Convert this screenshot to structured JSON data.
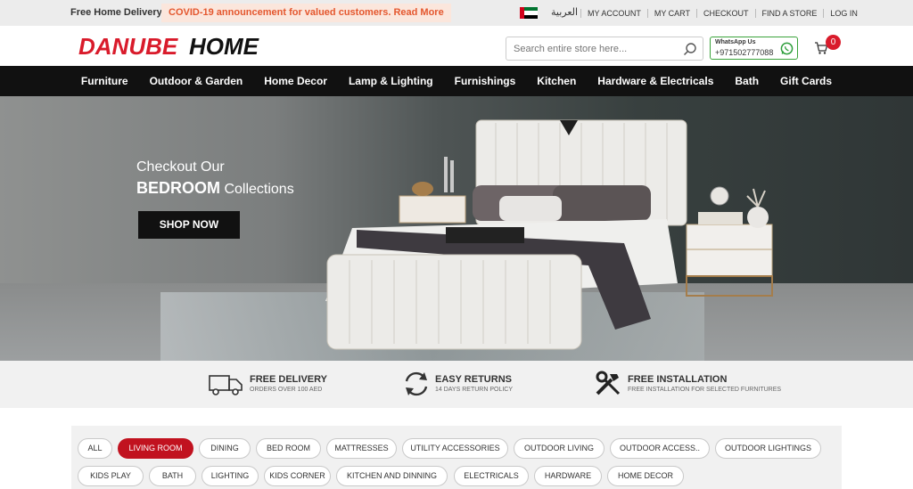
{
  "topbar": {
    "free_delivery": "Free Home Delivery",
    "covid_notice": "COVID-19 announcement for valued customers. Read More",
    "language": "العربية",
    "links": [
      "MY ACCOUNT",
      "MY CART",
      "CHECKOUT",
      "FIND A STORE",
      "LOG IN"
    ]
  },
  "header": {
    "logo_text": "DANUBE HOME",
    "search_placeholder": "Search entire store here...",
    "whatsapp_label": "WhatsApp Us",
    "whatsapp_number": "+971502777088",
    "cart_count": "0"
  },
  "nav": {
    "items": [
      "Furniture",
      "Outdoor & Garden",
      "Home Decor",
      "Lamp & Lighting",
      "Furnishings",
      "Kitchen",
      "Hardware & Electricals",
      "Bath",
      "Gift Cards"
    ]
  },
  "hero": {
    "line1": "Checkout Our",
    "line2_bold": "BEDROOM",
    "line2_rest": " Collections",
    "cta": "SHOP NOW"
  },
  "features": [
    {
      "title": "FREE DELIVERY",
      "subtitle": "ORDERS OVER 100 AED",
      "icon": "truck-icon"
    },
    {
      "title": "EASY RETURNS",
      "subtitle": "14 DAYS RETURN POLICY",
      "icon": "returns-icon"
    },
    {
      "title": "FREE INSTALLATION",
      "subtitle": "FREE INSTALLATION FOR SELECTED FURNITURES",
      "icon": "tools-icon"
    }
  ],
  "categories": {
    "active": "LIVING ROOM",
    "row1": [
      "ALL",
      "LIVING ROOM",
      "DINING",
      "BED ROOM",
      "MATTRESSES",
      "UTILITY ACCESSORIES",
      "OUTDOOR LIVING",
      "OUTDOOR ACCESS..",
      "OUTDOOR LIGHTINGS"
    ],
    "row2": [
      "KIDS PLAY",
      "BATH",
      "LIGHTING",
      "KIDS CORNER",
      "KITCHEN AND DINNING",
      "ELECTRICALS",
      "HARDWARE",
      "HOME DECOR"
    ]
  },
  "colors": {
    "brand_red": "#d91b2b",
    "nav_bg": "#111111",
    "covid_text": "#e4572e",
    "whatsapp_green": "#3aa33a"
  }
}
